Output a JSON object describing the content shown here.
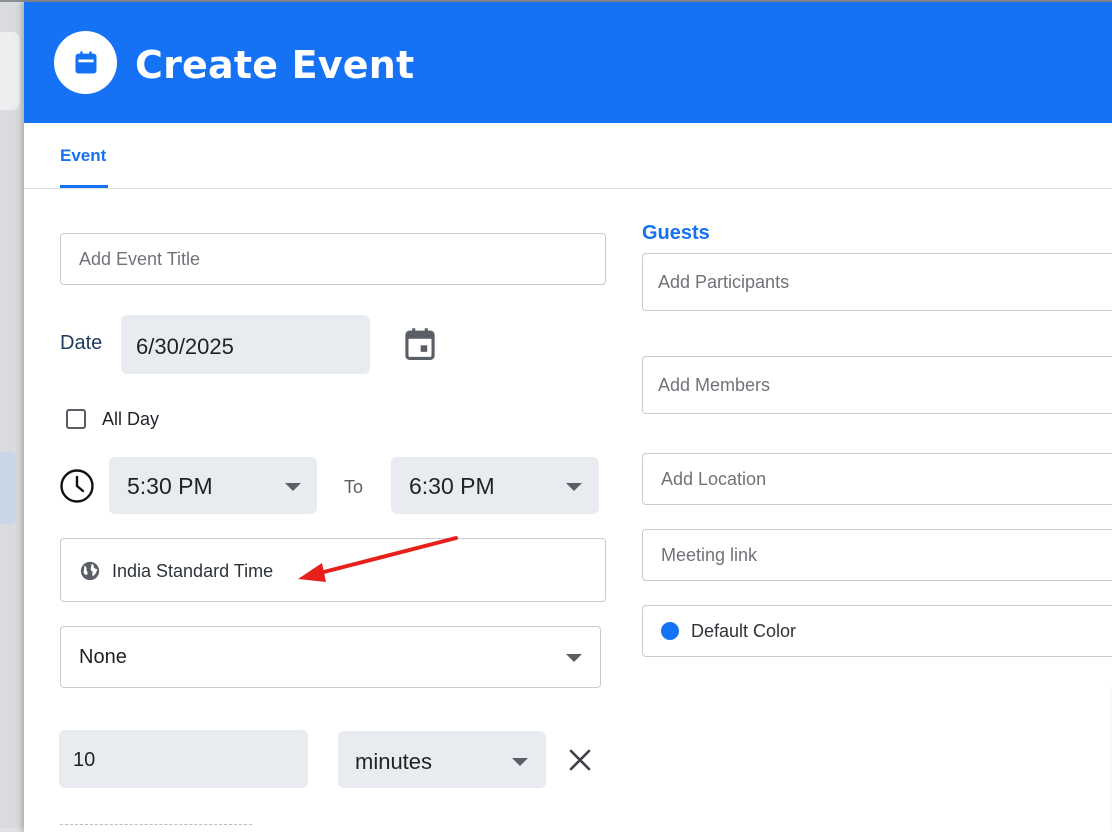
{
  "header": {
    "title": "Create Event",
    "icon": "calendar-icon",
    "accent": "#1672f4"
  },
  "tabs": [
    {
      "label": "Event",
      "active": true
    }
  ],
  "form": {
    "title_placeholder": "Add Event Title",
    "date_label": "Date",
    "date_value": "6/30/2025",
    "all_day_label": "All Day",
    "all_day_checked": false,
    "start_time": "5:30 PM",
    "to_label": "To",
    "end_time": "6:30 PM",
    "timezone": "India Standard Time",
    "repeat": "None",
    "reminder_value": "10",
    "reminder_unit": "minutes"
  },
  "guests": {
    "title": "Guests",
    "participants_placeholder": "Add Participants",
    "members_placeholder": "Add Members",
    "location_placeholder": "Add Location",
    "meeting_link_placeholder": "Meeting link",
    "color_label": "Default Color",
    "color_value": "#1672f4"
  },
  "annotation": {
    "arrow_color": "#e8201c"
  }
}
